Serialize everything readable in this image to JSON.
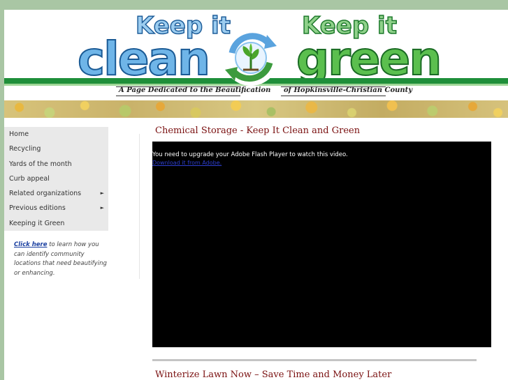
{
  "banner": {
    "keep_left": "Keep it",
    "keep_right": "Keep it",
    "clean": "clean",
    "green": "green",
    "tagline_left": "A Page Dedicated to the Beautification",
    "tagline_right": "of Hopkinsville-Christian County",
    "colors": {
      "blue": "#6fb5e8",
      "green": "#5bbf4e",
      "band": "#1f8f3a"
    },
    "emblem_icon": "recycle-sprout-icon"
  },
  "sidebar": {
    "items": [
      {
        "label": "Home",
        "has_submenu": false
      },
      {
        "label": "Recycling",
        "has_submenu": false
      },
      {
        "label": "Yards of the month",
        "has_submenu": false
      },
      {
        "label": "Curb appeal",
        "has_submenu": false
      },
      {
        "label": "Related organizations",
        "has_submenu": true
      },
      {
        "label": "Previous editions",
        "has_submenu": true
      },
      {
        "label": "Keeping it Green",
        "has_submenu": false
      }
    ],
    "submenu_arrow": "►",
    "note_link": "Click here",
    "note_text": " to learn how you can identify community locations that need beautifying or enhancing."
  },
  "main": {
    "post1_title": "Chemical Storage - Keep It Clean and Green",
    "video_message": "You need to upgrade your Adobe Flash Player to watch this video.",
    "video_link": "Download it from Adobe.",
    "post2_title": "Winterize Lawn Now – Save Time and Money Later"
  }
}
